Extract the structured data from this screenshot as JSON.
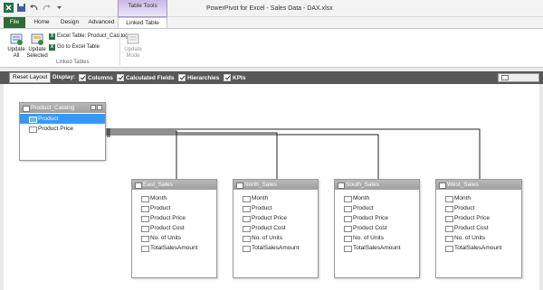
{
  "window": {
    "title": "PowerPivot for Excel - Sales Data - DAX.xlsx",
    "context_tab": "Table Tools"
  },
  "tabs": [
    "File",
    "Home",
    "Design",
    "Advanced",
    "Linked Table"
  ],
  "ribbon": {
    "update_all": "Update All",
    "update_selected": "Update Selected",
    "excel_table": "Excel Table: Product_Catalog",
    "go_to_excel": "Go to Excel Table",
    "update_mode": "Update Mode",
    "group_label": "Linked Tables"
  },
  "display_bar": {
    "reset_layout": "Reset Layout",
    "display_label": "Display:",
    "options": [
      {
        "label": "Columns",
        "checked": true
      },
      {
        "label": "Calculated Fields",
        "checked": true
      },
      {
        "label": "Hierarchies",
        "checked": true
      },
      {
        "label": "KPIs",
        "checked": true
      }
    ]
  },
  "tables": {
    "product_catalog": {
      "name": "Product_Catalog",
      "columns": [
        "Product",
        "Product Price"
      ],
      "selected_column": "Product"
    },
    "east_sales": {
      "name": "East_Sales",
      "columns": [
        "Month",
        "Product",
        "Product Price",
        "Product Cost",
        "No. of Units",
        "TotalSalesAmount"
      ]
    },
    "north_sales": {
      "name": "North_Sales",
      "columns": [
        "Month",
        "Product",
        "Product Price",
        "Product Cost",
        "No. of Units",
        "TotalSalesAmount"
      ]
    },
    "south_sales": {
      "name": "South_Sales",
      "columns": [
        "Month",
        "Product",
        "Product Price",
        "Product Cost",
        "No. of Units",
        "TotalSalesAmount"
      ]
    },
    "west_sales": {
      "name": "West_Sales",
      "columns": [
        "Month",
        "Product",
        "Product Price",
        "Product Cost",
        "No. of Units",
        "TotalSalesAmount"
      ]
    }
  },
  "colors": {
    "file_tab": "#2e6b37",
    "context_tab": "#c9b7e7",
    "selection": "#3399ff",
    "display_bar": "#585858"
  }
}
